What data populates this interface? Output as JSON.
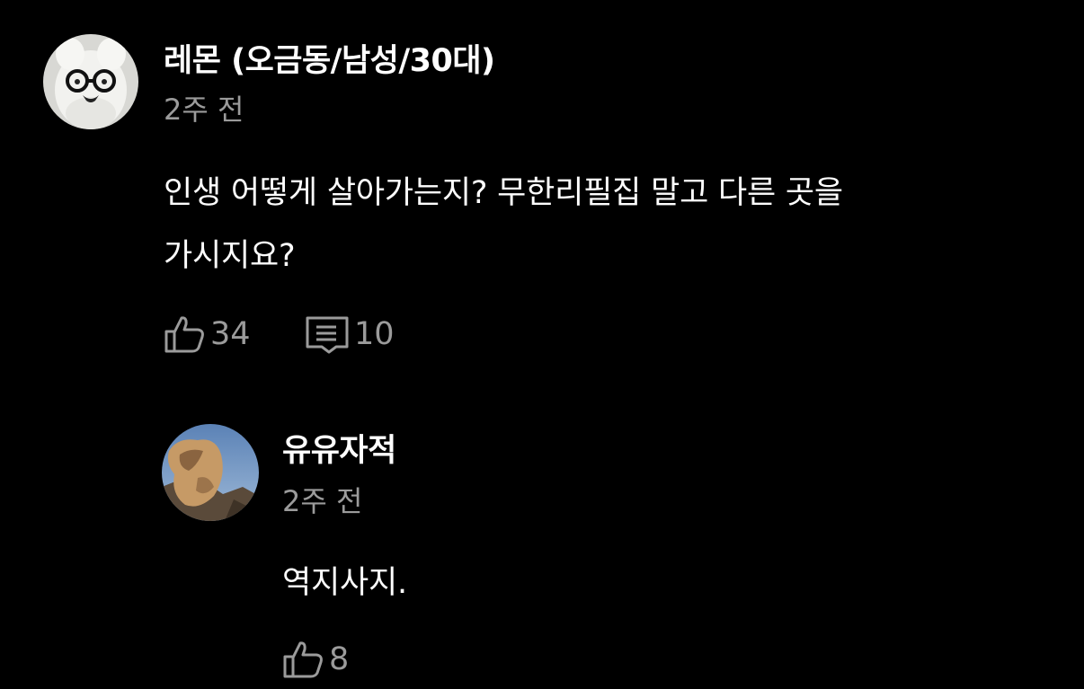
{
  "comments": [
    {
      "author": "레몬 (오금동/남성/30대)",
      "time": "2주 전",
      "body_lines": [
        "인생 어떻게 살아가는지? 무한리필집 말고 다른 곳을",
        "가시지요?"
      ],
      "likes": "34",
      "replies": "10",
      "avatar_icon": "plush-toy-with-glasses-avatar"
    },
    {
      "author": "유유자적",
      "time": "2주 전",
      "body_lines": [
        "역지사지."
      ],
      "likes": "8",
      "avatar_icon": "rock-landscape-avatar"
    }
  ],
  "colors": {
    "background": "#000000",
    "text": "#ffffff",
    "muted": "#9b9b9b"
  }
}
